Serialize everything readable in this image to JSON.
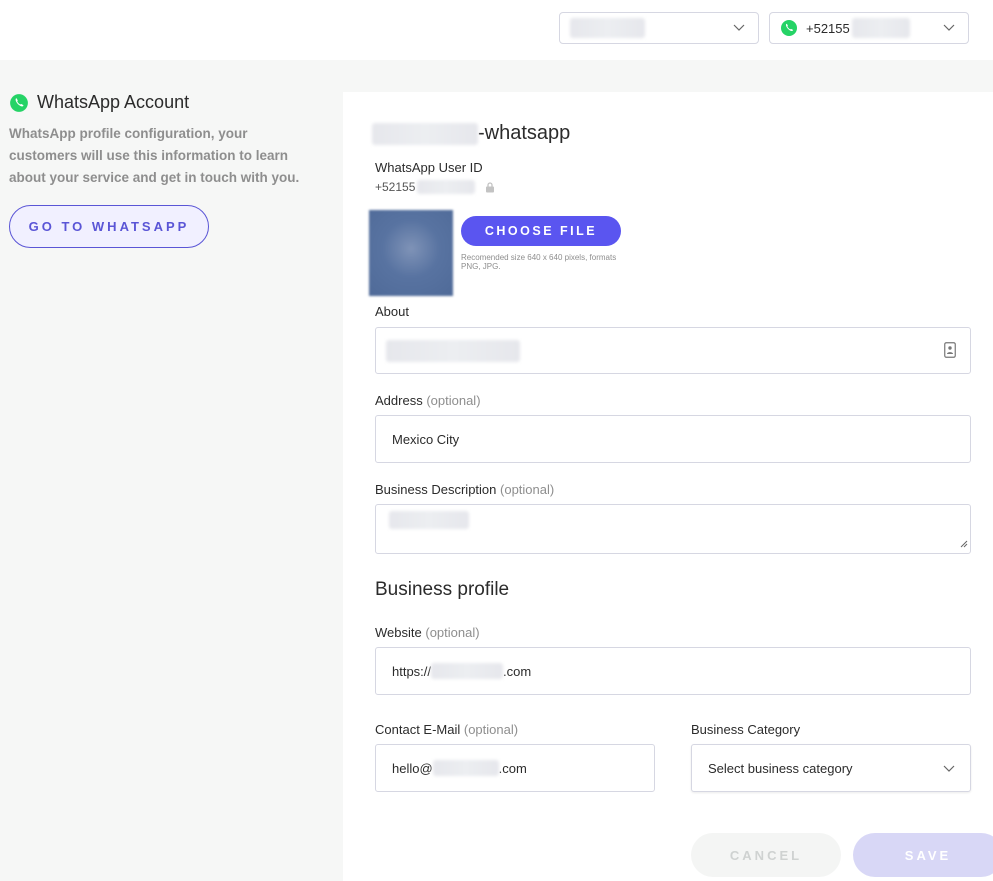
{
  "topbar": {
    "account_select": {
      "value": "",
      "redacted": true
    },
    "number_select": {
      "prefix": "+52155",
      "redacted_suffix": true
    }
  },
  "sidebar": {
    "title": "WhatsApp Account",
    "description": "WhatsApp profile configuration, your customers will use this information to learn about your service and get in touch with you.",
    "goto_label": "GO TO WHATSAPP"
  },
  "form": {
    "account_name_suffix": "-whatsapp",
    "user_id_label": "WhatsApp User ID",
    "user_id_prefix": "+52155",
    "choose_file_label": "CHOOSE FILE",
    "choose_file_hint": "Recomended size 640 x 640 pixels, formats PNG, JPG.",
    "about_label": "About",
    "address_label": "Address",
    "optional": "(optional)",
    "address_value": "Mexico City",
    "business_description_label": "Business Description",
    "business_profile_heading": "Business profile",
    "website_label": "Website",
    "website_prefix": "https://",
    "website_suffix": ".com",
    "contact_email_label": "Contact E-Mail",
    "email_prefix": "hello@",
    "email_suffix": ".com",
    "business_category_label": "Business Category",
    "business_category_placeholder": "Select business category",
    "cancel_label": "CANCEL",
    "save_label": "SAVE"
  },
  "colors": {
    "accent": "#5a55f0",
    "whatsapp_green": "#25d366",
    "muted_text": "#8e8e8e",
    "border": "#d6d7e2"
  },
  "icons": [
    "whatsapp-icon",
    "chevron-down-icon",
    "lock-icon",
    "contact-card-icon",
    "resize-handle-icon"
  ]
}
